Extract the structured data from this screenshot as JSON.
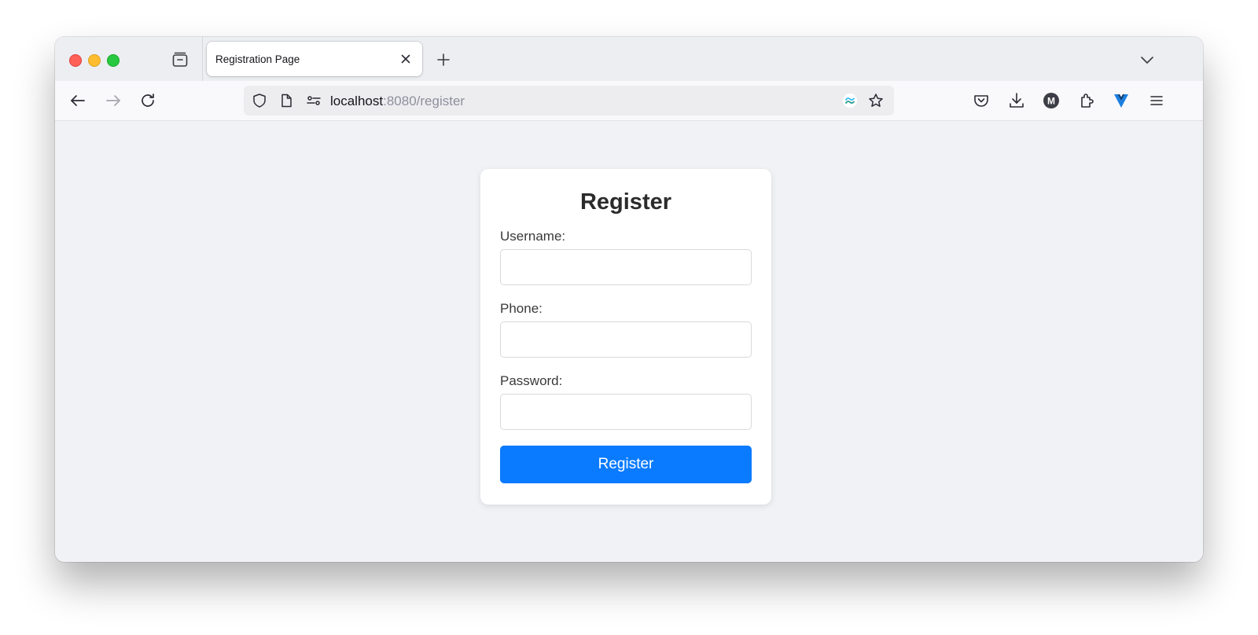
{
  "browser": {
    "tab": {
      "title": "Registration Page"
    },
    "url": {
      "host": "localhost",
      "rest": ":8080/register"
    },
    "colors": {
      "close": "#fe5f57",
      "minimize": "#febc2e",
      "maximize": "#28c840"
    }
  },
  "form": {
    "title": "Register",
    "username_label": "Username:",
    "phone_label": "Phone:",
    "password_label": "Password:",
    "submit_label": "Register",
    "accent_color": "#0a7bff"
  },
  "icons": {
    "tabstrip": [
      "firefox-view-icon",
      "close-tab-icon",
      "new-tab-icon",
      "list-all-tabs-icon"
    ],
    "toolbar": [
      "back-icon",
      "forward-icon",
      "reload-icon",
      "shield-icon",
      "page-icon",
      "permissions-icon",
      "tailwind-extension-icon",
      "bookmark-star-icon",
      "pocket-icon",
      "downloads-icon",
      "account-avatar-icon",
      "extensions-icon",
      "vue-devtools-icon",
      "menu-icon"
    ]
  },
  "account": {
    "avatar_letter": "M"
  }
}
